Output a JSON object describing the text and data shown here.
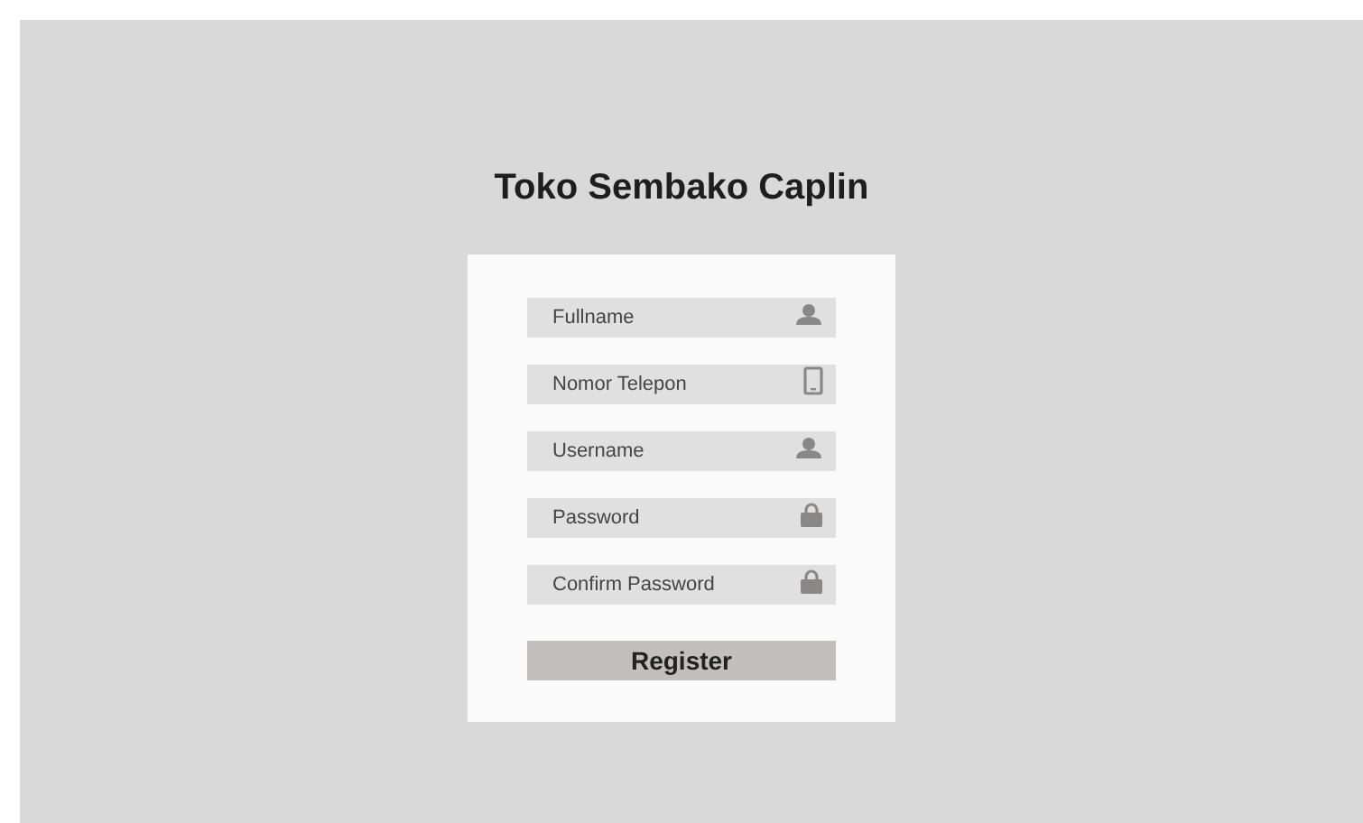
{
  "title": "Toko Sembako Caplin",
  "fields": [
    {
      "placeholder": "Fullname",
      "kind": "person"
    },
    {
      "placeholder": "Nomor Telepon",
      "kind": "phone"
    },
    {
      "placeholder": "Username",
      "kind": "person"
    },
    {
      "placeholder": "Password",
      "kind": "lock"
    },
    {
      "placeholder": "Confirm Password",
      "kind": "lock"
    }
  ],
  "button": "Register"
}
